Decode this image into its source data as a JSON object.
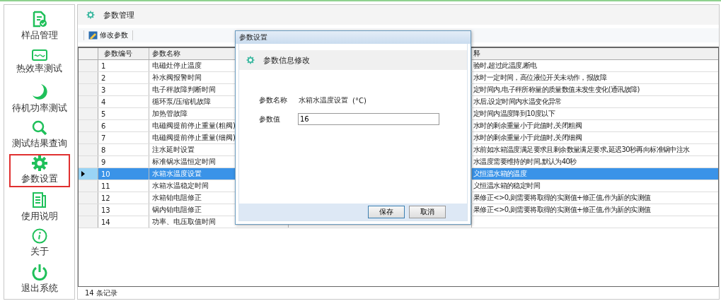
{
  "sidebar": {
    "items": [
      {
        "label": "样品管理",
        "selected": false
      },
      {
        "label": "热效率测试",
        "selected": false
      },
      {
        "label": "待机功率测试",
        "selected": false
      },
      {
        "label": "测试结果查询",
        "selected": false
      },
      {
        "label": "参数设置",
        "selected": true
      },
      {
        "label": "使用说明",
        "selected": false
      },
      {
        "label": "关于",
        "selected": false
      },
      {
        "label": "退出系统",
        "selected": false
      }
    ]
  },
  "panel": {
    "title": "参数管理"
  },
  "toolbar": {
    "buttons": [
      "修改参数"
    ]
  },
  "table": {
    "columns": [
      "参数编号",
      "参数名称",
      "释"
    ],
    "rows": [
      {
        "id": "1",
        "name": "电磁灶停止温度",
        "note": "验时,超过此温度,断电",
        "selected": false
      },
      {
        "id": "2",
        "name": "补水阀报警时间",
        "note": "水时一定时间，高位液位开关未动作，报故障",
        "selected": false
      },
      {
        "id": "3",
        "name": "电子秤故障判断时间",
        "note": "定时间内,电子秤所称量的质量数值未发生变化(通讯故障)",
        "selected": false
      },
      {
        "id": "4",
        "name": "循环泵/压缩机故障",
        "note": "水后,设定时间内水温变化异常",
        "selected": false
      },
      {
        "id": "5",
        "name": "加热管故障",
        "note": "定时间内温度降到10度以下",
        "selected": false
      },
      {
        "id": "6",
        "name": "电磁阀提前停止重量(粗阀)",
        "note": "水时的剩余重量小于此值时,关闭粗阀",
        "selected": false
      },
      {
        "id": "7",
        "name": "电磁阀提前停止重量(细阀)",
        "note": "水时的剩余重量小于此值时,关闭细阀",
        "selected": false
      },
      {
        "id": "8",
        "name": "注水延时设置",
        "note": "水前如水箱温度满足要求且剩余数量满足要求,延迟30秒再向标准锅中注水",
        "selected": false
      },
      {
        "id": "9",
        "name": "标准锅水温恒定时间",
        "note": "水温度需要维持的时间,默认为40秒",
        "selected": false
      },
      {
        "id": "10",
        "name": "水箱水温度设置",
        "note": "义恒温水箱的温度",
        "selected": true
      },
      {
        "id": "11",
        "name": "水箱水温稳定时间",
        "note": "义恒温水箱的稳定时间",
        "selected": false
      },
      {
        "id": "12",
        "name": "水箱铂电阻修正",
        "note": "果修正<>0,则需要将取得的实测值+修正值,作为新的实测值",
        "selected": false
      },
      {
        "id": "13",
        "name": "锅内铂电阻修正",
        "note": "果修正<>0,则需要将取得的实测值+修正值,作为新的实测值",
        "selected": false
      },
      {
        "id": "14",
        "name": "功率、电压取值时间",
        "selected": false
      }
    ]
  },
  "status_bar": "14 条记录",
  "dialog": {
    "title": "参数设置",
    "heading": "参数信息修改",
    "name_label": "参数名称",
    "name_value": "水箱水温度设置",
    "unit": "(°C)",
    "value_label": "参数值",
    "value": "16",
    "buttons": [
      {
        "label": "保存",
        "selected": true
      },
      {
        "label": "取消",
        "selected": false
      }
    ]
  }
}
